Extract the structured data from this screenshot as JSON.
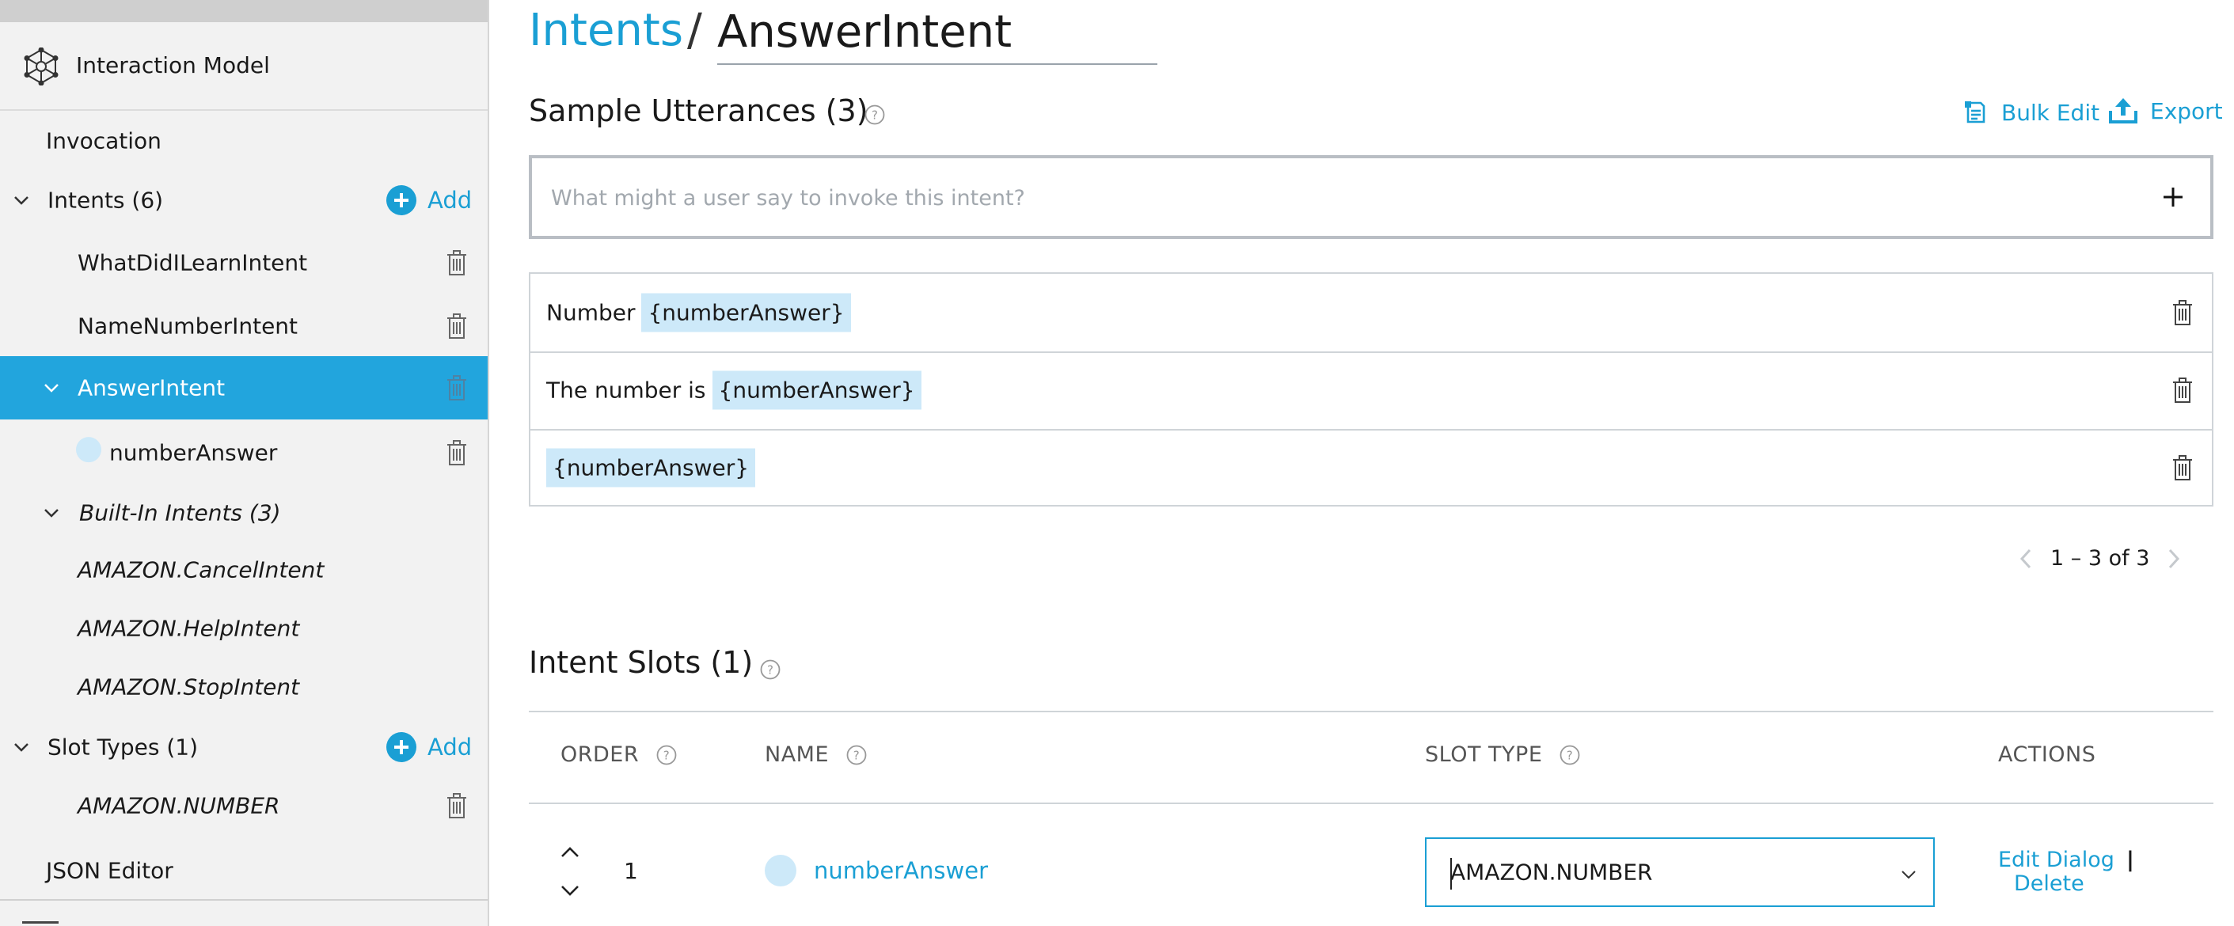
{
  "sidebar": {
    "header_label": "Interaction Model",
    "invocation": "Invocation",
    "intents_label": "Intents (6)",
    "add_label": "Add",
    "custom_intents": [
      "WhatDidILearnIntent",
      "NameNumberIntent",
      "AnswerIntent"
    ],
    "selected_intent": "AnswerIntent",
    "selected_slot": "numberAnswer",
    "builtin_label": "Built-In Intents (3)",
    "builtin_intents": [
      "AMAZON.CancelIntent",
      "AMAZON.HelpIntent",
      "AMAZON.StopIntent"
    ],
    "slot_types_label": "Slot Types (1)",
    "slot_types": [
      "AMAZON.NUMBER"
    ],
    "json_editor": "JSON Editor"
  },
  "breadcrumb": {
    "root": "Intents",
    "separator": "/",
    "intent_name": "AnswerIntent"
  },
  "utterances": {
    "title": "Sample Utterances (3)",
    "bulk_edit": "Bulk Edit",
    "export": "Export",
    "placeholder": "What might a user say to invoke this intent?",
    "rows": [
      {
        "text": "Number",
        "slot": "{numberAnswer}"
      },
      {
        "text": "The number is",
        "slot": "{numberAnswer}"
      },
      {
        "text": "",
        "slot": "{numberAnswer}"
      }
    ],
    "pager": "1 – 3 of 3"
  },
  "slots": {
    "title": "Intent Slots (1)",
    "headers": {
      "order": "ORDER",
      "name": "NAME",
      "slot_type": "SLOT TYPE",
      "actions": "ACTIONS"
    },
    "rows": [
      {
        "order": "1",
        "name": "numberAnswer",
        "slot_type": "AMAZON.NUMBER",
        "edit_dialog": "Edit Dialog",
        "separator": "|",
        "delete": "Delete"
      }
    ]
  },
  "colors": {
    "accent": "#1a9fd4",
    "selected_bg": "#22a5dd",
    "slot_chip": "#cde9f9",
    "sidebar_bg": "#f2f2f2"
  }
}
